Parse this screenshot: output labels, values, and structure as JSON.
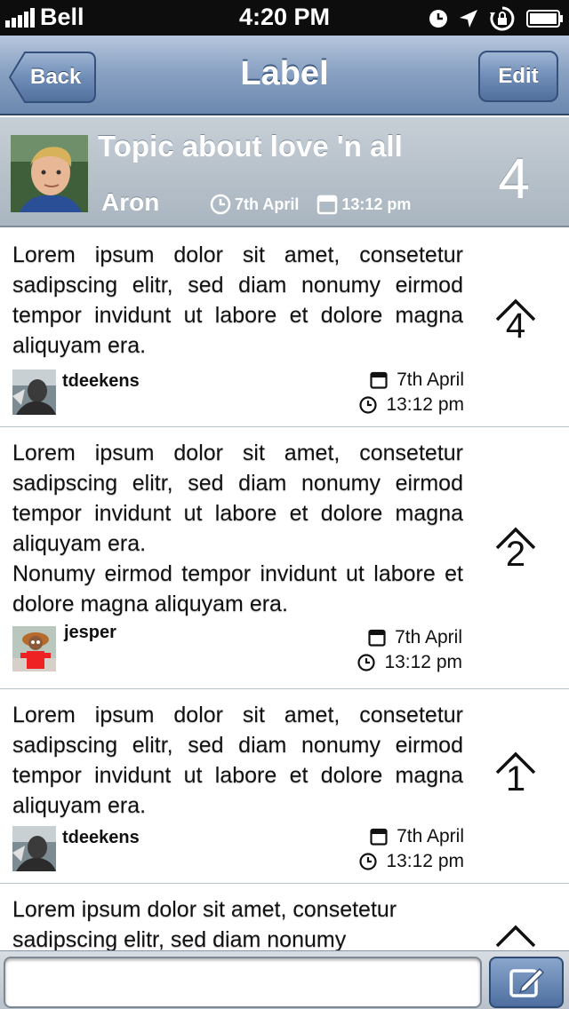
{
  "status_bar": {
    "carrier": "Bell",
    "time": "4:20 PM"
  },
  "nav": {
    "back_label": "Back",
    "title": "Label",
    "edit_label": "Edit"
  },
  "topic": {
    "title": "Topic about love 'n all",
    "author": "Aron",
    "date": "7th April",
    "time": "13:12 pm",
    "count": "4"
  },
  "posts": [
    {
      "paragraphs": [
        "Lorem ipsum dolor sit amet, consetetur sadipscing elitr, sed diam nonumy eirmod tempor invidunt ut labore et dolore magna aliquyam era."
      ],
      "user": "tdeekens",
      "date": "7th April",
      "time": "13:12 pm",
      "votes": "4"
    },
    {
      "paragraphs": [
        "Lorem ipsum dolor sit amet, consetetur sadipscing elitr, sed diam nonumy eirmod tempor invidunt ut labore et dolore magna aliquyam era.",
        "Nonumy eirmod tempor invidunt ut labore et dolore magna aliquyam era."
      ],
      "user": "jesper",
      "date": "7th April",
      "time": "13:12 pm",
      "votes": "2"
    },
    {
      "paragraphs": [
        "Lorem ipsum dolor sit amet, consetetur sadipscing elitr, sed diam nonumy eirmod tempor invidunt ut labore et dolore magna aliquyam era."
      ],
      "user": "tdeekens",
      "date": "7th April",
      "time": "13:12 pm",
      "votes": "1"
    },
    {
      "paragraphs": [
        "Lorem ipsum dolor sit amet, consetetur sadipscing elitr, sed diam nonumy"
      ]
    }
  ],
  "composer": {
    "value": ""
  }
}
